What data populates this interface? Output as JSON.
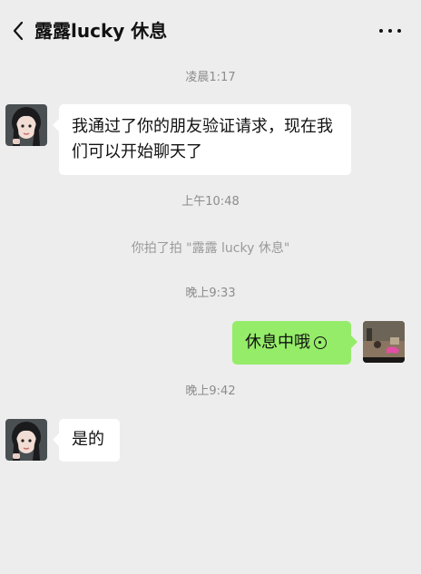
{
  "header": {
    "title": "露露lucky  休息",
    "back_icon": "chevron-left-icon",
    "more_icon": "more-dots-icon"
  },
  "messages": {
    "ts1": "凌晨1:17",
    "msg1": "我通过了你的朋友验证请求，现在我们可以开始聊天了",
    "ts2": "上午10:48",
    "pat": "你拍了拍 \"露露 lucky  休息\"",
    "ts3": "晚上9:33",
    "msg2": "休息中哦",
    "ts4": "晚上9:42",
    "msg3": "是的"
  },
  "colors": {
    "background": "#ededed",
    "bubble_self": "#95ec69",
    "bubble_other": "#ffffff"
  }
}
